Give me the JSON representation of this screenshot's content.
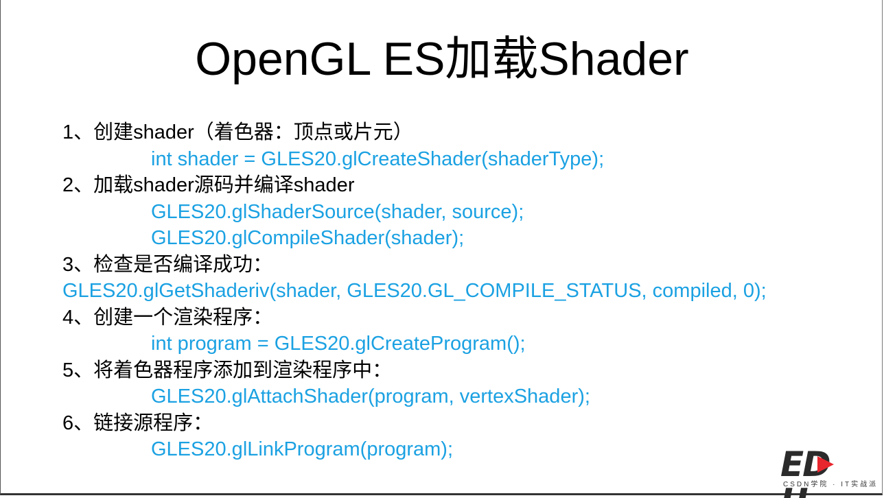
{
  "slide": {
    "title": "OpenGL ES加载Shader",
    "lines": [
      {
        "text": "1、创建shader（着色器：顶点或片元）",
        "kind": "step",
        "indent": false
      },
      {
        "text": "int shader = GLES20.glCreateShader(shaderType);",
        "kind": "code",
        "indent": true
      },
      {
        "text": "2、加载shader源码并编译shader",
        "kind": "step",
        "indent": false
      },
      {
        "text": "GLES20.glShaderSource(shader, source);",
        "kind": "code",
        "indent": true
      },
      {
        "text": "GLES20.glCompileShader(shader);",
        "kind": "code",
        "indent": true
      },
      {
        "text": "3、检查是否编译成功：",
        "kind": "step",
        "indent": false
      },
      {
        "text": "GLES20.glGetShaderiv(shader, GLES20.GL_COMPILE_STATUS, compiled, 0);",
        "kind": "code",
        "indent": false
      },
      {
        "text": "4、创建一个渲染程序：",
        "kind": "step",
        "indent": false
      },
      {
        "text": "int program = GLES20.glCreateProgram();",
        "kind": "code",
        "indent": true
      },
      {
        "text": "5、将着色器程序添加到渲染程序中：",
        "kind": "step",
        "indent": false
      },
      {
        "text": "GLES20.glAttachShader(program, vertexShader);",
        "kind": "code",
        "indent": true
      },
      {
        "text": "6、链接源程序：",
        "kind": "step",
        "indent": false
      },
      {
        "text": "GLES20.glLinkProgram(program);",
        "kind": "code",
        "indent": true
      }
    ]
  },
  "logo": {
    "text_left": "ED",
    "text_right": "U",
    "subtitle": "CSDN学院 · IT实战派",
    "play_color": "#e8262d"
  },
  "colors": {
    "step_text": "#000000",
    "code_text": "#1ba1e2"
  }
}
